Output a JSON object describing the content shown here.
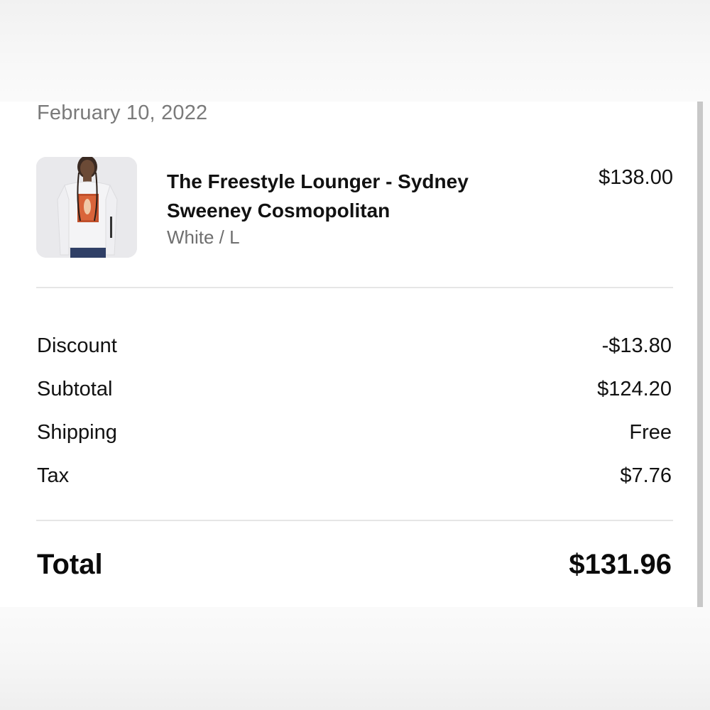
{
  "order": {
    "date": "February 10, 2022"
  },
  "item": {
    "title": "The Freestyle Lounger - Sydney\nSweeney  Cosmopolitan",
    "variant": "White / L",
    "price": "$138.00",
    "image_icon": "product-photo"
  },
  "summary": {
    "discount_label": "Discount",
    "discount_value": "-$13.80",
    "subtotal_label": "Subtotal",
    "subtotal_value": "$124.20",
    "shipping_label": "Shipping",
    "shipping_value": "Free",
    "tax_label": "Tax",
    "tax_value": "$7.76"
  },
  "total": {
    "label": "Total",
    "value": "$131.96"
  },
  "colors": {
    "text": "#111111",
    "muted": "#7a7a7a",
    "divider": "#e6e6e6",
    "thumb_bg": "#e9e9ec"
  }
}
